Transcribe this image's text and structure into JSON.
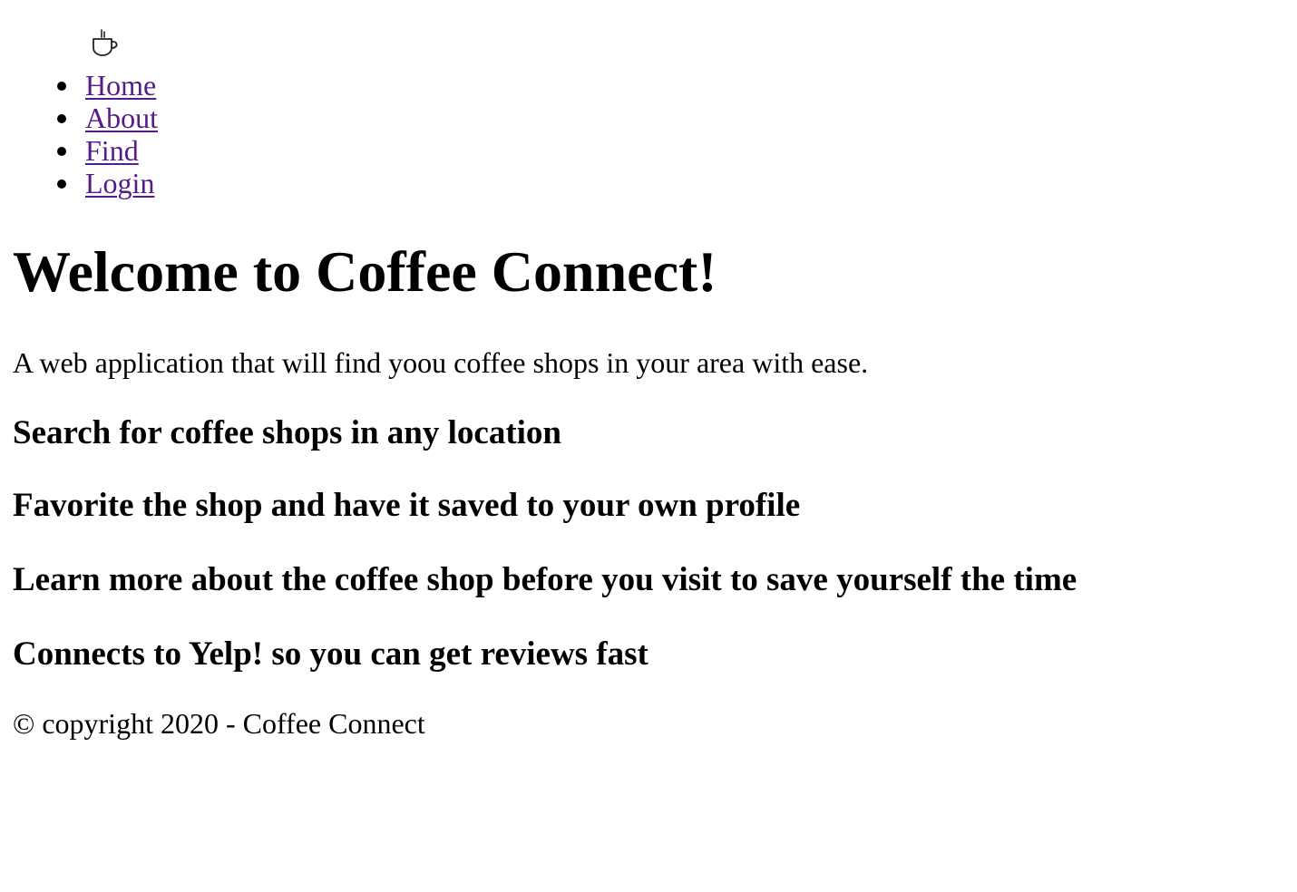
{
  "header": {
    "logo_icon": "coffee-cup-icon"
  },
  "nav": {
    "items": [
      {
        "label": "Home"
      },
      {
        "label": "About"
      },
      {
        "label": "Find"
      },
      {
        "label": "Login"
      }
    ],
    "link_color": "#551a8b"
  },
  "main": {
    "title": "Welcome to Coffee Connect!",
    "tagline": "A web application that will find yoou coffee shops in your area with ease.",
    "features": [
      "Search for coffee shops in any location",
      "Favorite the shop and have it saved to your own profile",
      "Learn more about the coffee shop before you visit to save yourself the time",
      "Connects to Yelp! so you can get reviews fast"
    ]
  },
  "footer": {
    "copyright": "© copyright 2020 - Coffee Connect"
  }
}
